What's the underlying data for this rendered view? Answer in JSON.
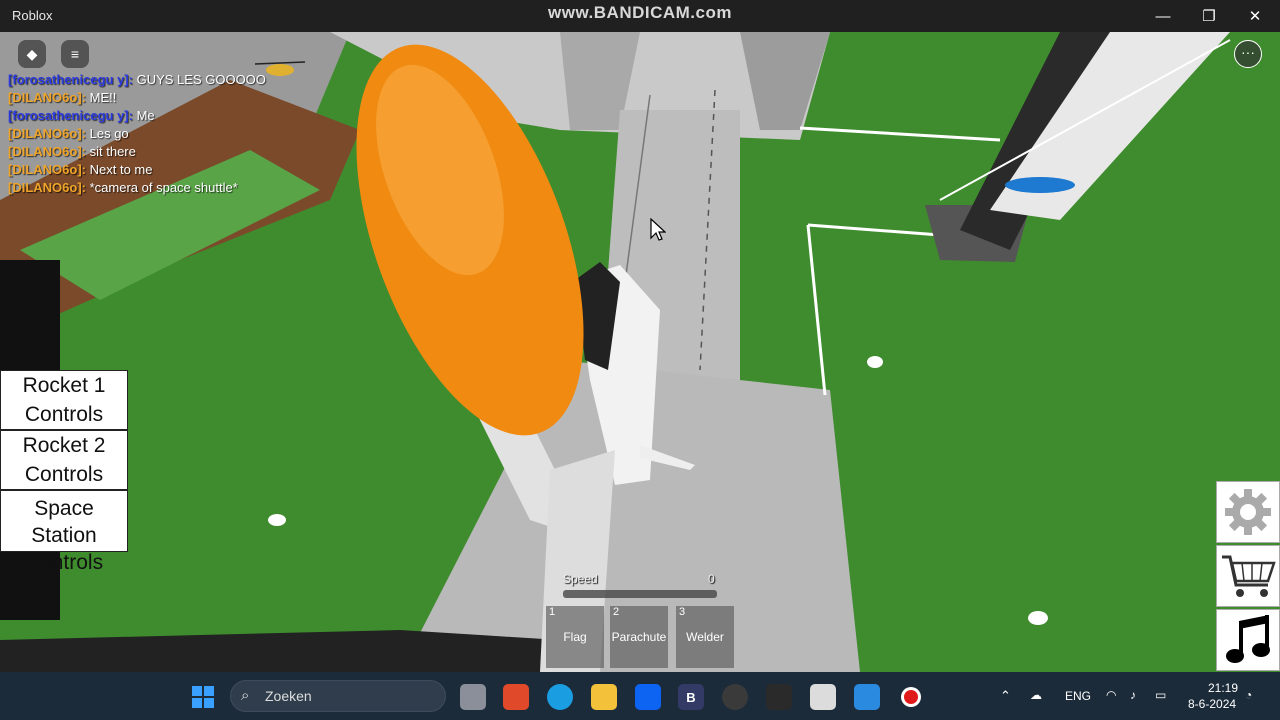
{
  "window": {
    "title": "Roblox",
    "watermark": "www.BANDICAM.com",
    "minimize_glyph": "—",
    "maximize_glyph": "❐",
    "close_glyph": "✕"
  },
  "top_icons": {
    "roblox_menu_glyph": "◆",
    "chat_glyph": "≡",
    "more_glyph": "···"
  },
  "chat": {
    "messages": [
      {
        "user": "[forosathenicegu y]:",
        "text": "GUYS LES GOOOOO",
        "color": "#2b3be0"
      },
      {
        "user": "[DILANO6o]:",
        "text": "ME!!",
        "color": "#f0a52a"
      },
      {
        "user": "[forosathenicegu y]:",
        "text": "Me",
        "color": "#2b3be0"
      },
      {
        "user": "[DILANO6o]:",
        "text": "Les go",
        "color": "#f0a52a"
      },
      {
        "user": "[DILANO6o]:",
        "text": "sit there",
        "color": "#f0a52a"
      },
      {
        "user": "[DILANO6o]:",
        "text": "Next to me",
        "color": "#f0a52a"
      },
      {
        "user": "[DILANO6o]:",
        "text": "*camera of space shuttle*",
        "color": "#f0a52a"
      }
    ]
  },
  "controls": {
    "rocket1": {
      "line1": "Rocket 1",
      "line2": "Controls"
    },
    "rocket2": {
      "line1": "Rocket 2",
      "line2": "Controls"
    },
    "station": {
      "line1": "Space Station",
      "line2": "Controls"
    }
  },
  "side_buttons": {
    "settings_icon": "gear-icon",
    "shop_icon": "shopping-cart-icon",
    "music_icon": "music-note-icon"
  },
  "speed": {
    "label": "Speed",
    "value": "0"
  },
  "hotbar": [
    {
      "num": "1",
      "label": "Flag"
    },
    {
      "num": "2",
      "label": "Parachute"
    },
    {
      "num": "3",
      "label": "Welder"
    }
  ],
  "taskbar": {
    "search_placeholder": "Zoeken",
    "pinned_b_label": "B",
    "language": "ENG",
    "time": "21:19",
    "date": "8-6-2024"
  },
  "colors": {
    "grass": "#3f8c2e",
    "concrete": "#b5b5b5",
    "fuel_tank": "#f08a10",
    "taskbar": "#1c2b3a"
  }
}
